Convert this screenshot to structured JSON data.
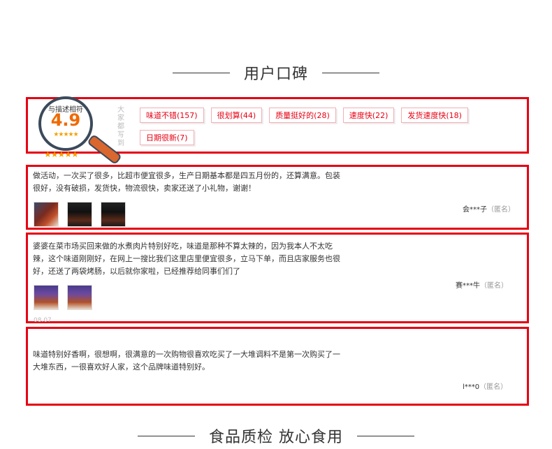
{
  "section_top": {
    "title": "用户口碑"
  },
  "summary": {
    "match_label": "与描述相符",
    "score": "4.9",
    "stars": "★★★★★",
    "vertical_label": "大家都写到",
    "tags": [
      "味道不错(157)",
      "很划算(44)",
      "质量挺好的(28)",
      "速度快(22)",
      "发货速度快(18)",
      "日期很新(7)"
    ]
  },
  "reviews": [
    {
      "text": "做活动，一次买了很多，比超市便宜很多，生产日期基本都是四五月份的，还算满意。包装很好，没有破损，发货快，物流很快，卖家还送了小礼物，谢谢！",
      "user": "会***子",
      "anon": "（匿名）",
      "date": ""
    },
    {
      "text": "婆婆在菜市场买回来做的水煮肉片特别好吃，味道是那种不算太辣的，因为我本人不太吃辣，这个味道刚刚好，在网上一搜比我们这里店里便宜很多，立马下单，而且店家服务也很好，还送了两袋烤肠，以后就你家啦，已经推荐给同事们们了",
      "user": "赛***牛",
      "anon": "（匿名）",
      "date": "08.07"
    },
    {
      "text": "味道特别好香啊，很想啊，很满意的一次购物很喜欢吃买了一大堆调料不是第一次购买了一大堆东西，一很喜欢好人家，这个品牌味道特别好。",
      "user": "l***0",
      "anon": "（匿名）",
      "date": ""
    }
  ],
  "section_bottom": {
    "title": "食品质检 放心食用"
  },
  "colors": {
    "accent": "#e60012",
    "score": "#f06a00",
    "star": "#f5a000"
  }
}
